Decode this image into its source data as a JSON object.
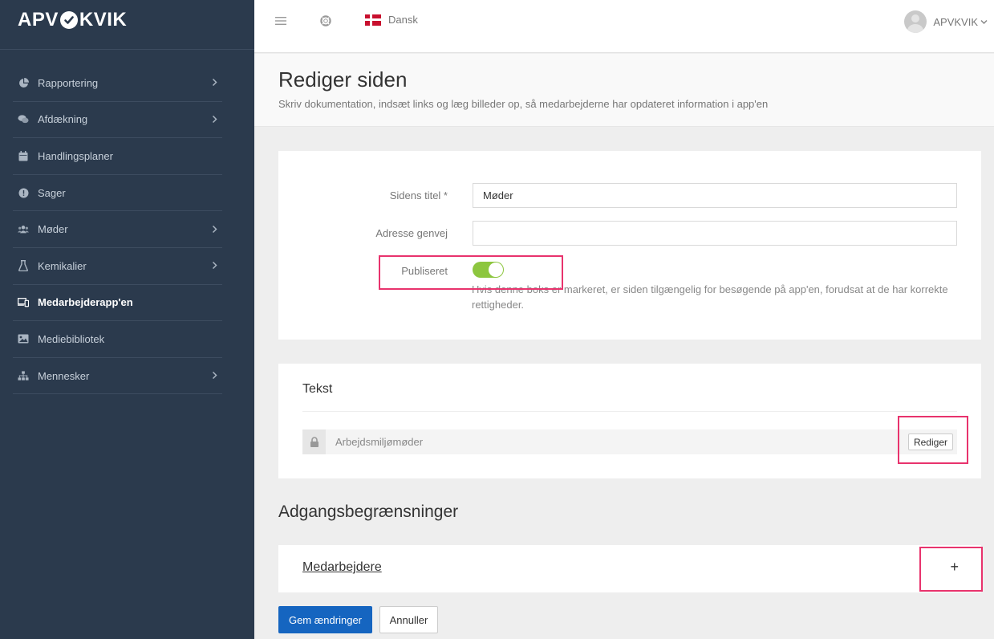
{
  "brand": {
    "left": "APV",
    "right": "KVIK"
  },
  "sidebar": {
    "items": [
      {
        "label": "Rapportering",
        "icon": "pie-chart-icon",
        "has_submenu": true,
        "active": false
      },
      {
        "label": "Afdækning",
        "icon": "comments-icon",
        "has_submenu": true,
        "active": false
      },
      {
        "label": "Handlingsplaner",
        "icon": "calendar-icon",
        "has_submenu": false,
        "active": false
      },
      {
        "label": "Sager",
        "icon": "exclamation-circle-icon",
        "has_submenu": false,
        "active": false
      },
      {
        "label": "Møder",
        "icon": "users-icon",
        "has_submenu": true,
        "active": false
      },
      {
        "label": "Kemikalier",
        "icon": "flask-icon",
        "has_submenu": true,
        "active": false
      },
      {
        "label": "Medarbejderapp'en",
        "icon": "devices-icon",
        "has_submenu": false,
        "active": true
      },
      {
        "label": "Mediebibliotek",
        "icon": "image-icon",
        "has_submenu": false,
        "active": false
      },
      {
        "label": "Mennesker",
        "icon": "sitemap-icon",
        "has_submenu": true,
        "active": false
      }
    ]
  },
  "topbar": {
    "language": "Dansk",
    "user": "APVKVIK"
  },
  "header": {
    "title": "Rediger siden",
    "subtitle": "Skriv dokumentation, indsæt links og læg billeder op, så medarbejderne har opdateret information i app'en"
  },
  "form": {
    "title_label": "Sidens titel *",
    "title_value": "Møder",
    "address_label": "Adresse genvej",
    "address_value": "",
    "published_label": "Publiseret",
    "published": true,
    "published_help": "Hvis denne boks er markeret, er siden tilgængelig for besøgende på app'en, forudsat at de har korrekte rettigheder."
  },
  "text_section": {
    "title": "Tekst",
    "item_label": "Arbejdsmiljømøder",
    "edit_label": "Rediger"
  },
  "access": {
    "heading": "Adgangsbegrænsninger",
    "group_label": "Medarbejdere",
    "add_symbol": "+"
  },
  "actions": {
    "save_label": "Gem ændringer",
    "cancel_label": "Annuller"
  },
  "colors": {
    "sidebar_bg": "#2b3a4d",
    "primary": "#1565c0",
    "toggle_on": "#8dc63f",
    "highlight": "#e8336d"
  }
}
